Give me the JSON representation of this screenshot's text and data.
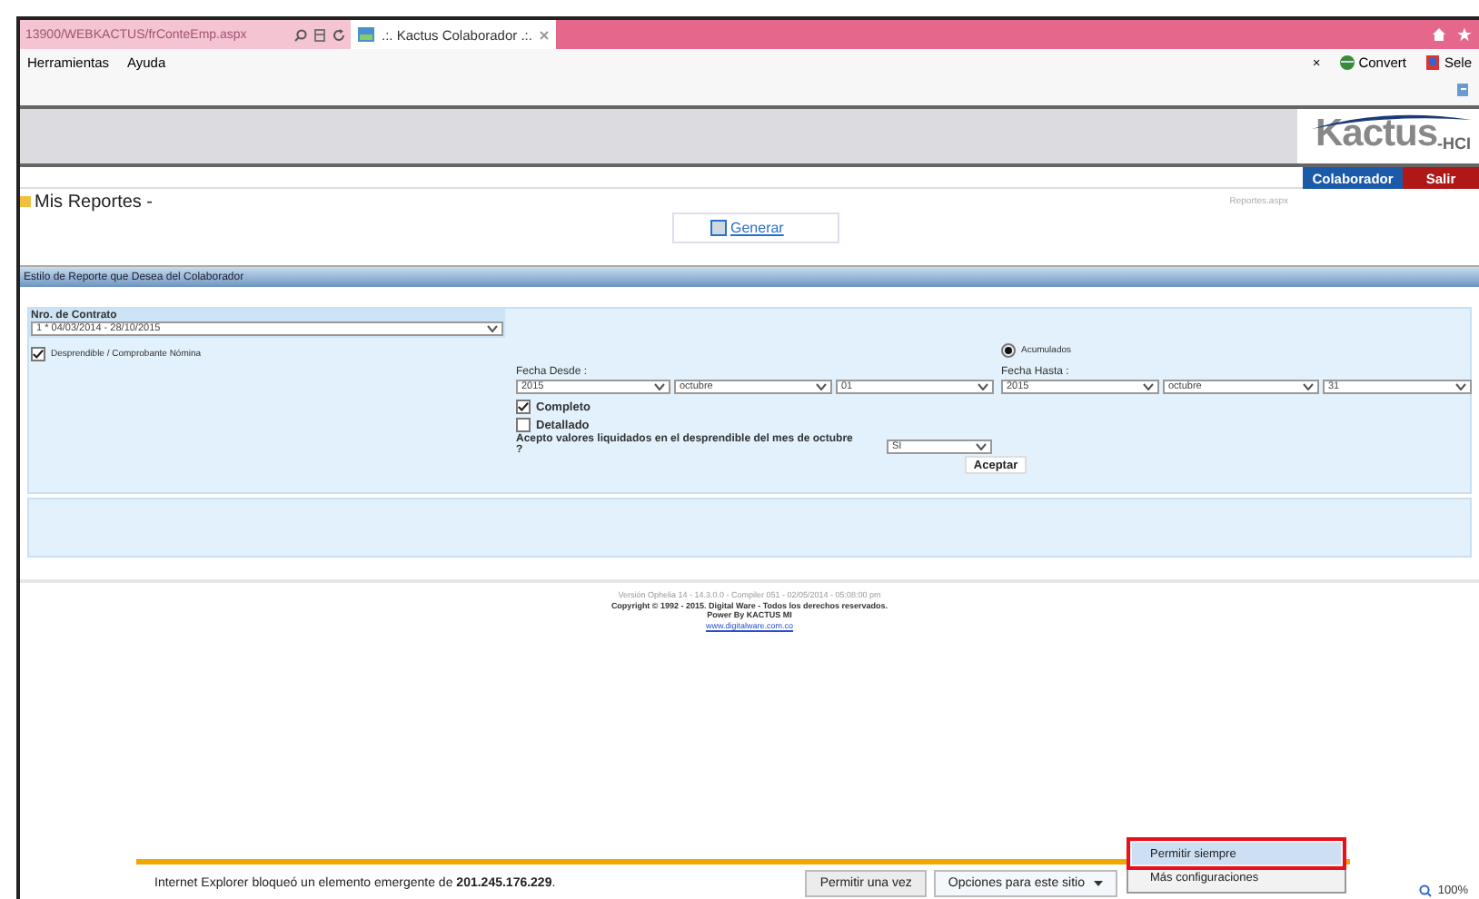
{
  "browser": {
    "address": "13900/WEBKACTUS/frConteEmp.aspx",
    "tab_title": ".:. Kactus Colaborador .:.",
    "menu": [
      "Herramientas",
      "Ayuda"
    ],
    "toolbar": [
      {
        "kind": "close",
        "label": "×"
      },
      {
        "kind": "convert",
        "label": "Convert"
      },
      {
        "kind": "select",
        "label": "Sele"
      }
    ]
  },
  "header": {
    "logo_main": "Kactus",
    "logo_suffix": "-HCI",
    "nav_buttons": [
      {
        "label": "Colaborador",
        "kind": "blue"
      },
      {
        "label": "Salir",
        "kind": "red"
      }
    ]
  },
  "page": {
    "title": "Mis Reportes -",
    "page_file": "Reportes.aspx",
    "generate_button": "Generar",
    "section_title": "Estilo de Reporte que Desea del Colaborador"
  },
  "form": {
    "contract_label": "Nro. de Contrato",
    "contract_value": "1 * 04/03/2014 - 28/10/2015",
    "payslip": {
      "label": "Desprendible / Comprobante Nómina",
      "checked": true
    },
    "accumulated": {
      "label": "Acumulados",
      "selected": true
    },
    "from_label": "Fecha Desde :",
    "from": [
      "2015",
      "octubre",
      "01"
    ],
    "to_label": "Fecha Hasta :",
    "to": [
      "2015",
      "octubre",
      "31"
    ],
    "options": [
      {
        "label": "Completo",
        "checked": true
      },
      {
        "label": "Detallado",
        "checked": false
      }
    ],
    "question": "Acepto valores liquidados en el desprendible del mes de octubre ?",
    "answer": "SI",
    "accept_button": "Aceptar"
  },
  "footer": {
    "lines": [
      "Versión Ophelia 14 - 14.3.0.0 - Compiler 051 - 02/05/2014 - 05:08:00 pm",
      "Copyright © 1992 - 2015. Digital Ware - Todos los derechos reservados.",
      "Power By KACTUS MI"
    ],
    "link": "www.digitalware.com.co"
  },
  "notification": {
    "message": "Internet Explorer bloqueó un elemento emergente de **201.245.176.229**.",
    "buttons": [
      {
        "label": "Permitir una vez",
        "kind": "plain"
      },
      {
        "label": "Opciones para este sitio",
        "kind": "menu"
      }
    ],
    "menu": [
      {
        "label": "Permitir siempre",
        "selected": true,
        "annotated": true
      },
      {
        "label": "Más configuraciones",
        "selected": false,
        "annotated": false
      }
    ]
  },
  "status": {
    "zoom": "100%"
  }
}
